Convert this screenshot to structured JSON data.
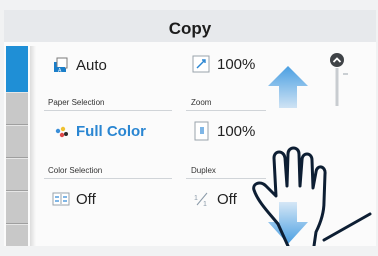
{
  "header": {
    "title": "Copy"
  },
  "settings": {
    "paper": {
      "value": "Auto",
      "label": "Paper Selection"
    },
    "zoom": {
      "value": "100%",
      "label": "Zoom"
    },
    "color": {
      "value": "Full Color",
      "label": "Color Selection"
    },
    "density": {
      "value": "100%"
    },
    "combine": {
      "value": "Off"
    },
    "duplex": {
      "value": "Off",
      "label": "Duplex"
    }
  },
  "icons": {
    "paper": "paper-tray-icon",
    "zoom": "zoom-icon",
    "color": "color-icon",
    "density": "density-icon",
    "combine": "combine-icon",
    "duplex": "duplex-icon",
    "up": "scroll-up-arrow-icon",
    "down": "scroll-down-arrow-icon",
    "hand": "hand-gesture-icon",
    "top": "scroll-top-icon"
  },
  "colors": {
    "accent": "#1f8fd6",
    "arrow": "#7fb6e6"
  }
}
